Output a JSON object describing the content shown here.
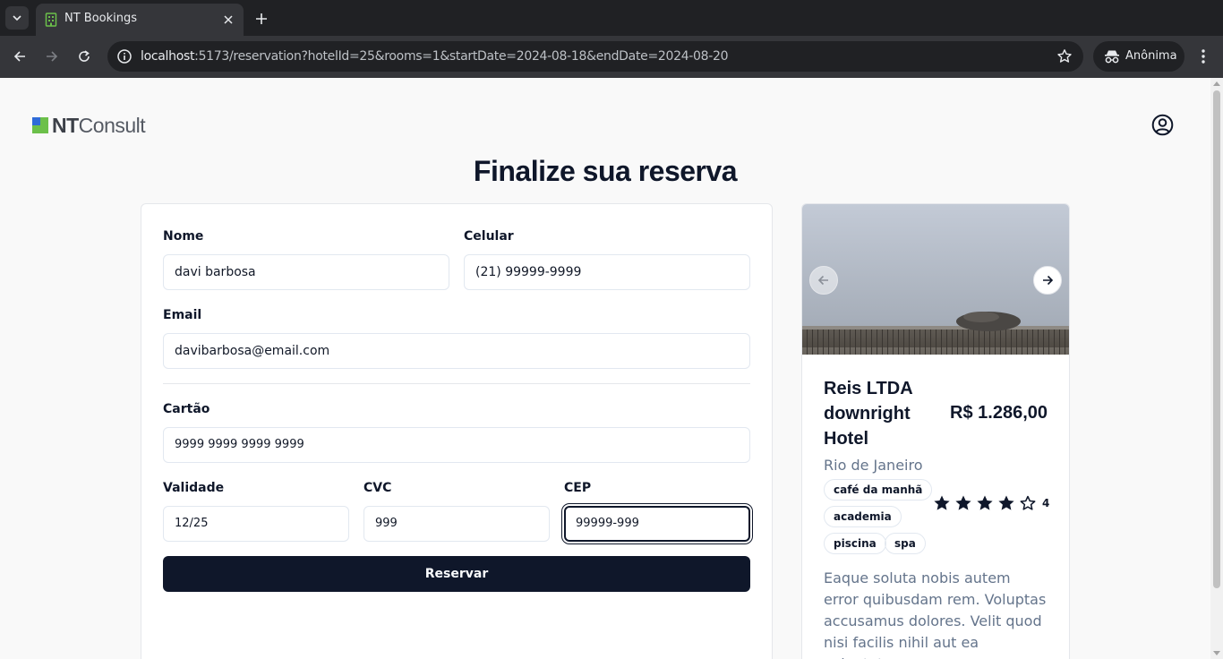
{
  "browser": {
    "tab_title": "NT Bookings",
    "url_host": "localhost",
    "url_rest": ":5173/reservation?hotelId=25&rooms=1&startDate=2024-08-18&endDate=2024-08-20",
    "profile_label": "Anônima"
  },
  "header": {
    "logo_bold": "NT",
    "logo_light": "Consult"
  },
  "page": {
    "title": "Finalize sua reserva"
  },
  "form": {
    "name_label": "Nome",
    "name_value": "davi barbosa",
    "phone_label": "Celular",
    "phone_value": "(21) 99999-9999",
    "email_label": "Email",
    "email_value": "davibarbosa@email.com",
    "card_label": "Cartão",
    "card_value": "9999 9999 9999 9999",
    "expiry_label": "Validade",
    "expiry_value": "12/25",
    "cvc_label": "CVC",
    "cvc_value": "999",
    "cep_label": "CEP",
    "cep_value": "99999-999",
    "submit_label": "Reservar"
  },
  "hotel": {
    "name": "Reis LTDA downright Hotel",
    "price": "R$ 1.286,00",
    "city": "Rio de Janeiro",
    "amenities": [
      "café da manhã",
      "academia",
      "piscina",
      "spa"
    ],
    "rating": "4",
    "description": "Eaque soluta nobis autem error quibusdam rem. Voluptas accusamus dolores. Velit quod nisi facilis nihil aut ea voluptates"
  },
  "colors": {
    "primary": "#0f172a",
    "muted": "#64748b",
    "border": "#e2e8f0"
  }
}
